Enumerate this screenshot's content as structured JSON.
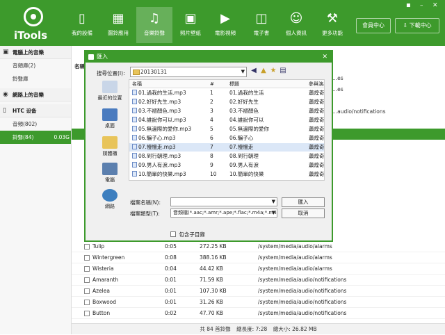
{
  "app": {
    "logo_text": "iTools",
    "window_controls": [
      "◾",
      "–",
      "✕"
    ],
    "nav": [
      {
        "label": "我的設備",
        "icon": "phone-icon"
      },
      {
        "label": "圖鈴應用",
        "icon": "apps-icon"
      },
      {
        "label": "音樂鈴聲",
        "icon": "music-icon"
      },
      {
        "label": "照片壁紙",
        "icon": "photo-icon"
      },
      {
        "label": "電影視頻",
        "icon": "video-icon"
      },
      {
        "label": "電子書",
        "icon": "book-icon"
      },
      {
        "label": "個人資訊",
        "icon": "person-icon"
      },
      {
        "label": "更多功能",
        "icon": "tools-icon"
      }
    ],
    "member_center": "會員中心",
    "download_center": "下載中心",
    "accent": "#3d9a2c"
  },
  "sidebar": {
    "groups": [
      {
        "title": "電腦上的音樂",
        "icon": "computer-icon",
        "items": [
          "音頻庫(2)",
          "鈴聲庫"
        ]
      },
      {
        "title": "網路上的音樂",
        "icon": "globe-icon",
        "items": []
      },
      {
        "title": "HTC 设备",
        "icon": "device-icon",
        "items": [
          "音頻(802)",
          "鈴聲(84)"
        ]
      }
    ],
    "selected_size": "0.03G",
    "name_header": "名稱"
  },
  "background_paths_top": [
    "...es",
    "...es",
    "...audio/notifications"
  ],
  "rows": [
    {
      "name": "Tulip",
      "duration": "0:05",
      "size": "272.25 KB",
      "path": "/system/media/audio/alarms"
    },
    {
      "name": "Wintergreen",
      "duration": "0:08",
      "size": "388.16 KB",
      "path": "/system/media/audio/alarms"
    },
    {
      "name": "Wisteria",
      "duration": "0:04",
      "size": "44.42 KB",
      "path": "/system/media/audio/alarms"
    },
    {
      "name": "Amaranth",
      "duration": "0:01",
      "size": "71.59 KB",
      "path": "/system/media/audio/notifications"
    },
    {
      "name": "Azelea",
      "duration": "0:01",
      "size": "107.30 KB",
      "path": "/system/media/audio/notifications"
    },
    {
      "name": "Boxwood",
      "duration": "0:01",
      "size": "31.26 KB",
      "path": "/system/media/audio/notifications"
    },
    {
      "name": "Button",
      "duration": "0:02",
      "size": "47.70 KB",
      "path": "/system/media/audio/notifications"
    }
  ],
  "status": {
    "total": "共 84 首鈴聲",
    "duration": "總長度: 7:28",
    "size": "總大小: 26.82 MB"
  },
  "dialog": {
    "title": "匯入",
    "lookin_label": "搜尋位置(I):",
    "lookin_value": "20130131",
    "places": [
      "最近的位置",
      "桌面",
      "媒體櫃",
      "電腦",
      "網路"
    ],
    "columns": {
      "name": "名稱",
      "num": "#",
      "title": "標題",
      "artist": "參與演出"
    },
    "files": [
      {
        "name": "01.過我的生活.mp3",
        "num": "1",
        "title": "01.過我的生活",
        "artist": "蕭煌奇"
      },
      {
        "name": "02.好好先生.mp3",
        "num": "2",
        "title": "02.好好先生",
        "artist": "蕭煌奇"
      },
      {
        "name": "03.不褪顏色.mp3",
        "num": "3",
        "title": "03.不褪顏色",
        "artist": "蕭煌奇"
      },
      {
        "name": "04.誰說你可以.mp3",
        "num": "4",
        "title": "04.誰說你可以",
        "artist": "蕭煌奇"
      },
      {
        "name": "05.無邊際的愛你.mp3",
        "num": "5",
        "title": "05.無邊際的愛你",
        "artist": "蕭煌奇"
      },
      {
        "name": "06.騙子心.mp3",
        "num": "6",
        "title": "06.騙子心",
        "artist": "蕭煌奇"
      },
      {
        "name": "07.慢慢走.mp3",
        "num": "7",
        "title": "07.慢慢走",
        "artist": "蕭煌奇"
      },
      {
        "name": "08.到行朝理.mp3",
        "num": "8",
        "title": "08.到行朝理",
        "artist": "蕭煌奇"
      },
      {
        "name": "09.男人有淚.mp3",
        "num": "9",
        "title": "09.男人有淚",
        "artist": "蕭煌奇"
      },
      {
        "name": "10.簡單的快樂.mp3",
        "num": "10",
        "title": "10.簡單的快樂",
        "artist": "蕭煌奇"
      }
    ],
    "selected_index": 6,
    "filename_label": "檔案名稱(N):",
    "filename_value": "",
    "filetype_label": "檔案類型(T):",
    "filetype_value": "音頻檔(*.aac;*.amr;*.ape;*.flac;*.m4a;*.m4r;*.",
    "open_button": "匯入",
    "cancel_button": "取消",
    "include_subdir": "包含子目錄"
  }
}
